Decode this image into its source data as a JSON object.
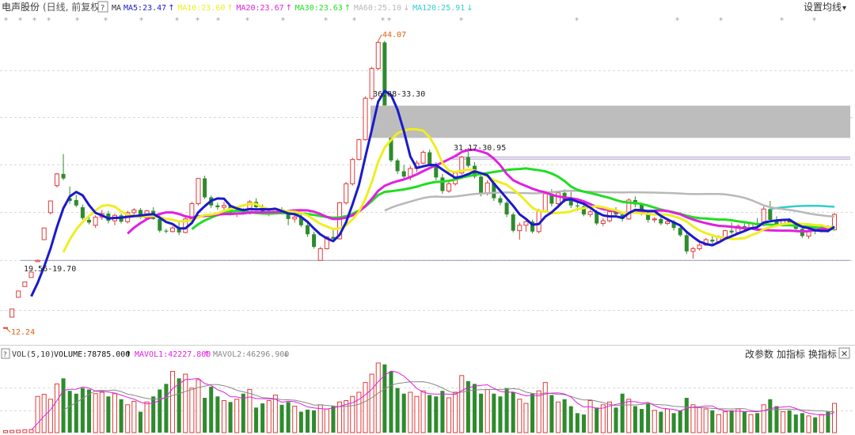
{
  "header": {
    "stock_name": "电声股份",
    "period": "(日线, 前复权)",
    "help_icon": "?",
    "ma_label": "MA",
    "settings_label": "设置均线",
    "settings_arrow": "▾"
  },
  "ma_items": [
    {
      "label": "MA5:23.47",
      "arrow": "↑",
      "color": "#1a1acc"
    },
    {
      "label": "MA10:23.60",
      "arrow": "↑",
      "color": "#eeee22"
    },
    {
      "label": "MA20:23.67",
      "arrow": "↑",
      "color": "#e020e0"
    },
    {
      "label": "MA30:23.63",
      "arrow": "↑",
      "color": "#22dd22"
    },
    {
      "label": "MA60:25.10",
      "arrow": "↓",
      "color": "#b8b8b8"
    },
    {
      "label": "MA120:25.91",
      "arrow": "↓",
      "color": "#33cccc"
    }
  ],
  "price_annotations": {
    "high": "44.07",
    "low": "12.24",
    "gap_upper": "36.88-33.30",
    "gap_lower": "31.17-30.95",
    "gap_bottom": "19.56-19.70"
  },
  "volume_header": {
    "vol": "VOL(5,10)",
    "volume": "VOLUME:78785.000",
    "volume_arrow": "↑",
    "mavol1": "MAVOL1:42227.800",
    "mavol1_arrow": "↑",
    "mavol2": "MAVOL2:46296.900",
    "mavol2_arrow": "↓",
    "btn_params": "改参数",
    "btn_add": "加指标",
    "btn_switch": "换指标",
    "close_icon": "✕"
  },
  "colors": {
    "up": "#e03a3a",
    "down": "#2e8b2e",
    "gap_fill": "#bdbdbd",
    "ma5": "#1a1acc",
    "ma10": "#eeee22",
    "ma20": "#e020e0",
    "ma30": "#22dd22",
    "ma60": "#b8b8b8",
    "ma120": "#33cccc",
    "high_label": "#e06010"
  },
  "chart_data": {
    "type": "candlestick",
    "title": "电声股份 (日线, 前复权)",
    "ylim": [
      10.5,
      46.5
    ],
    "ohlc": [
      [
        12.2,
        12.2,
        12.24,
        12.24
      ],
      [
        13.4,
        14.3,
        13.4,
        14.3
      ],
      [
        15.6,
        16.3,
        15.6,
        16.3
      ],
      [
        16.8,
        17.3,
        16.8,
        17.3
      ],
      [
        17.8,
        18.4,
        17.8,
        18.4
      ],
      [
        19.56,
        19.8,
        19.56,
        19.7
      ],
      [
        22.0,
        23.3,
        22.0,
        23.3
      ],
      [
        25.0,
        26.3,
        24.8,
        26.3
      ],
      [
        28.0,
        29.4,
        27.8,
        29.3
      ],
      [
        29.3,
        31.5,
        28.6,
        28.8
      ],
      [
        26.6,
        27.9,
        26.0,
        26.3
      ],
      [
        26.4,
        27.0,
        25.6,
        25.8
      ],
      [
        25.6,
        25.9,
        24.2,
        24.4
      ],
      [
        24.2,
        24.5,
        23.7,
        23.9
      ],
      [
        23.6,
        24.7,
        23.3,
        24.5
      ],
      [
        24.5,
        25.3,
        24.2,
        24.9
      ],
      [
        24.9,
        25.2,
        23.8,
        24.1
      ],
      [
        24.1,
        24.9,
        23.6,
        24.7
      ],
      [
        24.7,
        24.9,
        23.8,
        24.0
      ],
      [
        24.0,
        25.2,
        23.8,
        25.0
      ],
      [
        25.0,
        25.5,
        24.7,
        25.3
      ],
      [
        25.3,
        25.5,
        24.3,
        24.4
      ],
      [
        24.4,
        25.3,
        24.2,
        25.2
      ],
      [
        25.2,
        25.6,
        24.2,
        24.3
      ],
      [
        24.3,
        24.8,
        22.8,
        23.0
      ],
      [
        23.0,
        23.2,
        22.7,
        22.9
      ],
      [
        22.9,
        23.5,
        22.8,
        23.3
      ],
      [
        23.3,
        24.0,
        22.5,
        22.8
      ],
      [
        22.8,
        24.5,
        22.7,
        24.3
      ],
      [
        24.3,
        26.2,
        24.0,
        26.0
      ],
      [
        26.0,
        28.8,
        25.8,
        28.8
      ],
      [
        28.8,
        29.1,
        26.5,
        26.7
      ],
      [
        26.7,
        26.9,
        25.5,
        25.8
      ],
      [
        25.8,
        26.1,
        25.3,
        25.6
      ],
      [
        25.6,
        26.2,
        25.0,
        25.8
      ],
      [
        25.8,
        25.9,
        24.7,
        24.9
      ],
      [
        24.9,
        25.4,
        24.5,
        25.2
      ],
      [
        25.2,
        25.5,
        24.8,
        24.9
      ],
      [
        24.9,
        26.4,
        24.8,
        26.2
      ],
      [
        26.2,
        26.6,
        25.4,
        25.6
      ],
      [
        25.6,
        25.9,
        24.8,
        25.0
      ],
      [
        25.0,
        25.3,
        24.6,
        25.1
      ],
      [
        25.1,
        25.5,
        24.9,
        25.3
      ],
      [
        25.3,
        25.6,
        24.8,
        24.9
      ],
      [
        24.9,
        25.2,
        23.6,
        24.3
      ],
      [
        24.3,
        24.7,
        23.9,
        24.5
      ],
      [
        24.5,
        24.9,
        23.4,
        23.6
      ],
      [
        23.6,
        23.9,
        22.3,
        22.6
      ],
      [
        22.6,
        22.9,
        21.0,
        21.2
      ],
      [
        19.7,
        21.2,
        19.7,
        21.0
      ],
      [
        21.0,
        22.4,
        20.9,
        22.3
      ],
      [
        22.3,
        23.2,
        21.8,
        22.1
      ],
      [
        22.1,
        26.2,
        22.0,
        26.1
      ],
      [
        26.1,
        28.4,
        25.9,
        28.2
      ],
      [
        28.2,
        31.1,
        28.0,
        30.9
      ],
      [
        30.9,
        33.2,
        30.8,
        33.1
      ],
      [
        33.1,
        37.9,
        33.0,
        37.7
      ],
      [
        37.7,
        41.2,
        37.5,
        41.0
      ],
      [
        41.0,
        44.07,
        40.8,
        43.9
      ],
      [
        43.9,
        44.07,
        36.9,
        36.9
      ],
      [
        33.3,
        33.3,
        30.6,
        30.8
      ],
      [
        30.8,
        31.0,
        29.3,
        29.6
      ],
      [
        29.6,
        30.3,
        28.7,
        29.0
      ],
      [
        29.0,
        30.2,
        28.6,
        29.9
      ],
      [
        29.9,
        30.8,
        29.5,
        30.5
      ],
      [
        30.5,
        31.9,
        30.4,
        31.7
      ],
      [
        31.7,
        32.0,
        30.2,
        30.4
      ],
      [
        30.4,
        30.6,
        28.6,
        28.9
      ],
      [
        28.9,
        29.3,
        27.1,
        27.4
      ],
      [
        27.4,
        28.5,
        27.2,
        28.2
      ],
      [
        28.2,
        29.6,
        28.0,
        29.4
      ],
      [
        29.4,
        31.3,
        29.2,
        31.17
      ],
      [
        31.17,
        32.2,
        30.0,
        30.2
      ],
      [
        30.2,
        30.6,
        28.8,
        29.0
      ],
      [
        29.0,
        29.3,
        26.8,
        27.1
      ],
      [
        27.1,
        28.6,
        26.9,
        28.3
      ],
      [
        28.3,
        28.6,
        26.3,
        26.6
      ],
      [
        26.6,
        26.9,
        25.8,
        26.1
      ],
      [
        26.1,
        26.3,
        24.5,
        24.8
      ],
      [
        24.8,
        25.0,
        22.8,
        23.0
      ],
      [
        23.0,
        23.9,
        22.0,
        23.6
      ],
      [
        23.6,
        24.3,
        22.9,
        24.0
      ],
      [
        24.0,
        24.2,
        22.7,
        22.9
      ],
      [
        22.9,
        25.4,
        22.7,
        25.2
      ],
      [
        25.2,
        27.3,
        25.0,
        27.1
      ],
      [
        27.1,
        27.6,
        25.7,
        26.0
      ],
      [
        26.0,
        27.4,
        25.8,
        27.2
      ],
      [
        27.2,
        27.6,
        26.1,
        26.4
      ],
      [
        26.4,
        27.3,
        25.5,
        25.8
      ],
      [
        25.8,
        26.3,
        25.2,
        25.7
      ],
      [
        25.7,
        25.9,
        24.6,
        24.8
      ],
      [
        24.8,
        25.3,
        24.5,
        25.1
      ],
      [
        25.1,
        25.3,
        23.6,
        23.8
      ],
      [
        23.8,
        24.4,
        23.5,
        24.1
      ],
      [
        24.1,
        25.3,
        23.9,
        25.1
      ],
      [
        25.1,
        25.6,
        24.6,
        24.8
      ],
      [
        24.8,
        25.0,
        24.0,
        24.3
      ],
      [
        24.3,
        26.6,
        24.2,
        26.4
      ],
      [
        26.4,
        26.8,
        25.6,
        25.9
      ],
      [
        25.9,
        26.1,
        24.7,
        25.0
      ],
      [
        25.0,
        25.1,
        23.9,
        24.2
      ],
      [
        24.2,
        24.5,
        23.9,
        24.3
      ],
      [
        24.3,
        24.6,
        23.6,
        23.8
      ],
      [
        23.8,
        24.3,
        23.6,
        24.0
      ],
      [
        24.0,
        24.2,
        23.0,
        23.3
      ],
      [
        23.3,
        23.5,
        22.3,
        22.5
      ],
      [
        22.5,
        22.8,
        20.4,
        20.7
      ],
      [
        20.7,
        21.2,
        19.9,
        21.0
      ],
      [
        21.0,
        21.6,
        20.8,
        21.4
      ],
      [
        21.4,
        22.2,
        21.3,
        22.0
      ],
      [
        22.0,
        22.6,
        21.5,
        21.8
      ],
      [
        21.8,
        22.5,
        21.6,
        22.3
      ],
      [
        22.3,
        23.1,
        22.1,
        23.0
      ],
      [
        23.0,
        23.9,
        22.6,
        22.8
      ],
      [
        22.8,
        23.7,
        22.6,
        23.5
      ],
      [
        23.5,
        23.8,
        22.9,
        23.2
      ],
      [
        23.2,
        24.0,
        23.1,
        23.8
      ],
      [
        23.8,
        24.4,
        23.3,
        23.6
      ],
      [
        23.6,
        25.7,
        23.5,
        25.4
      ],
      [
        25.4,
        26.3,
        23.9,
        24.2
      ],
      [
        24.2,
        24.6,
        23.4,
        23.7
      ],
      [
        23.7,
        24.3,
        23.5,
        24.1
      ],
      [
        24.1,
        24.4,
        23.5,
        23.7
      ],
      [
        23.7,
        23.9,
        23.0,
        23.2
      ],
      [
        23.2,
        23.5,
        22.2,
        22.4
      ],
      [
        22.4,
        23.2,
        22.1,
        23.0
      ],
      [
        23.0,
        23.3,
        22.6,
        22.9
      ],
      [
        22.9,
        23.6,
        22.8,
        23.4
      ],
      [
        23.4,
        23.6,
        22.8,
        23.1
      ],
      [
        23.1,
        25.0,
        23.0,
        24.8
      ]
    ],
    "volume": [
      3000,
      3200,
      3500,
      4000,
      4500,
      52000,
      55000,
      48000,
      70000,
      78000,
      60000,
      56000,
      64000,
      62000,
      56000,
      58000,
      52000,
      56000,
      48000,
      40000,
      45000,
      30000,
      44000,
      52000,
      62000,
      70000,
      88000,
      78000,
      84000,
      64000,
      76000,
      50000,
      66000,
      52000,
      46000,
      44000,
      48000,
      56000,
      62000,
      36000,
      42000,
      46000,
      54000,
      40000,
      44000,
      38000,
      30000,
      33000,
      32000,
      40000,
      34000,
      38000,
      44000,
      46000,
      52000,
      58000,
      72000,
      84000,
      100000,
      98000,
      88000,
      64000,
      56000,
      58000,
      52000,
      60000,
      54000,
      52000,
      60000,
      50000,
      58000,
      82000,
      74000,
      70000,
      56000,
      62000,
      56000,
      52000,
      64000,
      58000,
      48000,
      42000,
      56000,
      60000,
      72000,
      54000,
      44000,
      48000,
      38000,
      28000,
      26000,
      46000,
      36000,
      40000,
      44000,
      36000,
      56000,
      48000,
      38000,
      34000,
      42000,
      32000,
      30000,
      34000,
      28000,
      32000,
      50000,
      40000,
      36000,
      34000,
      32000,
      26000,
      30000,
      32000,
      34000,
      30000,
      26000,
      28000,
      40000,
      48000,
      38000,
      30000,
      32000,
      26000,
      28000,
      24000,
      22000,
      26000,
      30000,
      42000
    ],
    "ma_values": {
      "MA5": 23.47,
      "MA10": 23.6,
      "MA20": 23.67,
      "MA30": 23.63,
      "MA60": 25.1,
      "MA120": 25.91
    },
    "gaps": [
      {
        "label": "36.88-33.30",
        "low": 33.3,
        "high": 36.88
      },
      {
        "label": "31.17-30.95",
        "low": 30.95,
        "high": 31.17
      },
      {
        "label": "19.56-19.70",
        "low": 19.56,
        "high": 19.7
      }
    ],
    "high_label": "44.07",
    "low_label": "12.24",
    "volume_indicator": {
      "VOLUME": 78785.0,
      "MAVOL1": 42227.8,
      "MAVOL2": 46296.9
    },
    "ma_periods": [
      5,
      10,
      20,
      30,
      60,
      120
    ],
    "mavol_periods": [
      5,
      10
    ]
  }
}
